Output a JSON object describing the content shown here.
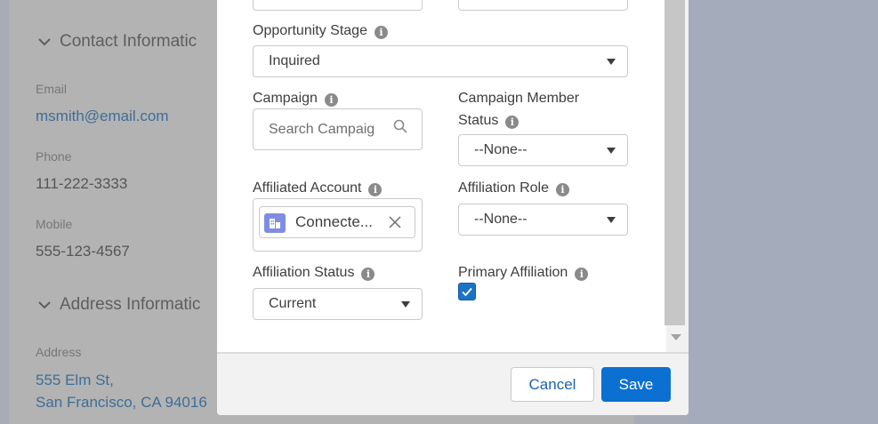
{
  "background": {
    "contact_section": "Contact Informatic",
    "email_label": "Email",
    "email_value": "msmith@email.com",
    "phone_label": "Phone",
    "phone_value": "111-222-3333",
    "mobile_label": "Mobile",
    "mobile_value": "555-123-4567",
    "address_section": "Address Informatic",
    "address_label": "Address",
    "address_line1": "555 Elm St,",
    "address_line2": "San Francisco, CA 94016"
  },
  "form": {
    "opportunity_stage_label": "Opportunity Stage",
    "opportunity_stage_value": "Inquired",
    "campaign_label": "Campaign",
    "campaign_placeholder": "Search Campaig",
    "campaign_member_status_label_line1": "Campaign Member",
    "campaign_member_status_label_line2": "Status",
    "campaign_member_status_value": "--None--",
    "affiliated_account_label": "Affiliated Account",
    "affiliated_account_value": "Connecte...",
    "affiliation_role_label": "Affiliation Role",
    "affiliation_role_value": "--None--",
    "affiliation_status_label": "Affiliation Status",
    "affiliation_status_value": "Current",
    "primary_affiliation_label": "Primary Affiliation",
    "primary_affiliation_checked": true,
    "info_glyph": "i"
  },
  "footer": {
    "cancel_label": "Cancel",
    "save_label": "Save"
  },
  "icons": {
    "chevron": "chevron-down-icon",
    "info": "info-icon",
    "search": "search-icon",
    "account": "account-icon",
    "close": "close-icon",
    "check": "checkmark-icon"
  },
  "colors": {
    "brand": "#0b70d2",
    "link": "#1b62b0",
    "checkbox": "#1b73c8",
    "account_icon": "#7f8de1"
  }
}
